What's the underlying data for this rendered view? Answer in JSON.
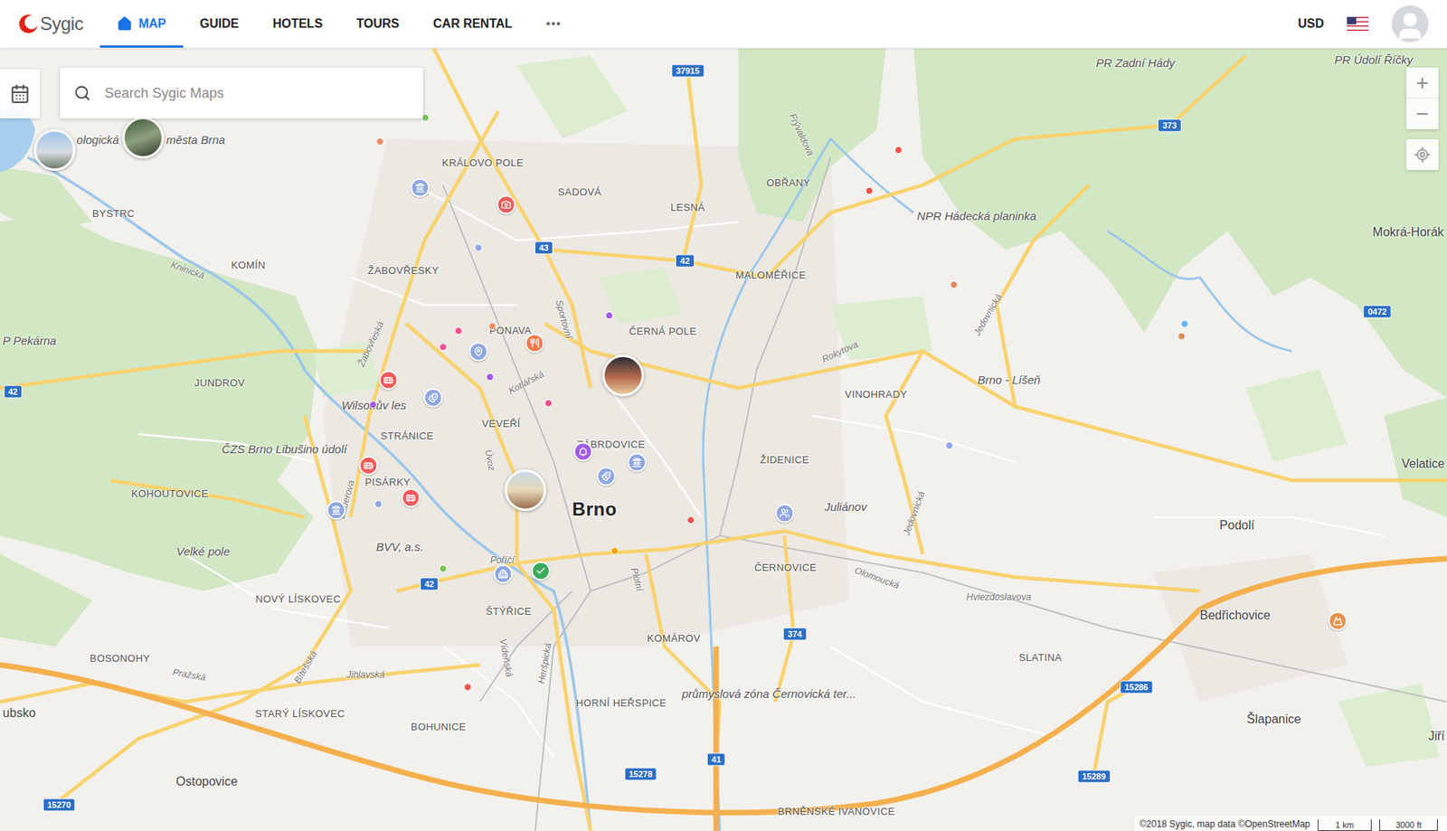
{
  "header": {
    "logo": "Sygic",
    "nav": [
      {
        "label": "MAP",
        "selected": true
      },
      {
        "label": "GUIDE",
        "selected": false
      },
      {
        "label": "HOTELS",
        "selected": false
      },
      {
        "label": "TOURS",
        "selected": false
      },
      {
        "label": "CAR RENTAL",
        "selected": false
      }
    ],
    "more": "•••",
    "currency": "USD"
  },
  "search": {
    "placeholder": "Search Sygic Maps"
  },
  "zoom": {
    "in": "+",
    "out": "−"
  },
  "map": {
    "labels": [
      {
        "text": "ologická",
        "kind": "area"
      },
      {
        "text": "města Brna",
        "kind": "area"
      },
      {
        "text": "KRÁLOVO POLE",
        "kind": "district"
      },
      {
        "text": "SADOVÁ",
        "kind": "district"
      },
      {
        "text": "LESNÁ",
        "kind": "district"
      },
      {
        "text": "OBŘANY",
        "kind": "district"
      },
      {
        "text": "PR Zadní Hády",
        "kind": "area"
      },
      {
        "text": "PR Údolí Říčky",
        "kind": "area"
      },
      {
        "text": "NPR Hádecká planinka",
        "kind": "area"
      },
      {
        "text": "Mokrá-Horák",
        "kind": "town"
      },
      {
        "text": "BYSTRC",
        "kind": "district"
      },
      {
        "text": "KOMÍN",
        "kind": "district"
      },
      {
        "text": "Kninická",
        "kind": "street"
      },
      {
        "text": "ŽABOVŘESKY",
        "kind": "district"
      },
      {
        "text": "PONAVA",
        "kind": "district"
      },
      {
        "text": "ČERNÁ POLE",
        "kind": "district"
      },
      {
        "text": "MALOMĚŘICE",
        "kind": "district"
      },
      {
        "text": "P Pekárna",
        "kind": "area"
      },
      {
        "text": "JUNDROV",
        "kind": "district"
      },
      {
        "text": "Wilsonův les",
        "kind": "area"
      },
      {
        "text": "Žabovřeská",
        "kind": "street"
      },
      {
        "text": "Sportovní",
        "kind": "street"
      },
      {
        "text": "Kotlářská",
        "kind": "street"
      },
      {
        "text": "VEVEŘÍ",
        "kind": "district"
      },
      {
        "text": "STRÁNICE",
        "kind": "district"
      },
      {
        "text": "ZÁBRDOVICE",
        "kind": "district"
      },
      {
        "text": "ŽIDENICE",
        "kind": "district"
      },
      {
        "text": "VINOHRADY",
        "kind": "district"
      },
      {
        "text": "Rokytova",
        "kind": "street"
      },
      {
        "text": "Brno - Líšeň",
        "kind": "area"
      },
      {
        "text": "Jedovnická",
        "kind": "street"
      },
      {
        "text": "ČZS Brno Libušino údolí",
        "kind": "area"
      },
      {
        "text": "PISÁRKY",
        "kind": "district"
      },
      {
        "text": "KOHOUTOVICE",
        "kind": "district"
      },
      {
        "text": "Brno",
        "kind": "city"
      },
      {
        "text": "Juliánov",
        "kind": "area"
      },
      {
        "text": "Jedovnická",
        "kind": "street"
      },
      {
        "text": "Podolí",
        "kind": "town"
      },
      {
        "text": "Velatice",
        "kind": "town"
      },
      {
        "text": "Velké pole",
        "kind": "area"
      },
      {
        "text": "BVV, a.s.",
        "kind": "area"
      },
      {
        "text": "Bauerova",
        "kind": "street"
      },
      {
        "text": "Úvoz",
        "kind": "street"
      },
      {
        "text": "Poříčí",
        "kind": "street"
      },
      {
        "text": "Plotní",
        "kind": "street"
      },
      {
        "text": "ČERNOVICE",
        "kind": "district"
      },
      {
        "text": "Olomoucká",
        "kind": "street"
      },
      {
        "text": "Hviezdoslavova",
        "kind": "street"
      },
      {
        "text": "NOVÝ LÍSKOVEC",
        "kind": "district"
      },
      {
        "text": "ŠTÝŘICE",
        "kind": "district"
      },
      {
        "text": "KOMÁROV",
        "kind": "district"
      },
      {
        "text": "Bedřichovice",
        "kind": "town"
      },
      {
        "text": "SLATINA",
        "kind": "district"
      },
      {
        "text": "BOSONOHY",
        "kind": "district"
      },
      {
        "text": "Pražská",
        "kind": "street"
      },
      {
        "text": "Jihlavská",
        "kind": "street"
      },
      {
        "text": "Bítešská",
        "kind": "street"
      },
      {
        "text": "Vídeňská",
        "kind": "street"
      },
      {
        "text": "Heršpická",
        "kind": "street"
      },
      {
        "text": "HORNÍ HEŘSPICE",
        "kind": "district"
      },
      {
        "text": "průmyslová zóna Černovická ter...",
        "kind": "area"
      },
      {
        "text": "ubsko",
        "kind": "town"
      },
      {
        "text": "STARÝ LÍSKOVEC",
        "kind": "district"
      },
      {
        "text": "BOHUNICE",
        "kind": "district"
      },
      {
        "text": "Šlapanice",
        "kind": "town"
      },
      {
        "text": "Jiří",
        "kind": "town"
      },
      {
        "text": "Ostopovice",
        "kind": "town"
      },
      {
        "text": "BRNĚNSKÉ IVANOVICE",
        "kind": "district"
      },
      {
        "text": "Frývaldova",
        "kind": "street"
      }
    ],
    "shields": [
      "37915",
      "373",
      "43",
      "42",
      "0472",
      "42",
      "42",
      "374",
      "15286",
      "41",
      "15278",
      "15289",
      "15270"
    ],
    "dots": [
      {
        "color": "#f28b62"
      },
      {
        "color": "#7cc35b"
      },
      {
        "color": "#ef5350"
      },
      {
        "color": "#ef5350"
      },
      {
        "color": "#d98c5f"
      },
      {
        "color": "#d98c5f"
      },
      {
        "color": "#64b5f6"
      },
      {
        "color": "#8fa7e0"
      },
      {
        "color": "#ef4f8b"
      },
      {
        "color": "#ef4f8b"
      },
      {
        "color": "#f28b62"
      },
      {
        "color": "#a259e6"
      },
      {
        "color": "#a259e6"
      },
      {
        "color": "#ef4f8b"
      },
      {
        "color": "#a259e6"
      },
      {
        "color": "#8fa7e0"
      },
      {
        "color": "#ef5350"
      },
      {
        "color": "#f0a500"
      },
      {
        "color": "#7cc35b"
      },
      {
        "color": "#ef5350"
      },
      {
        "color": "#8fa7e0"
      }
    ],
    "markers": [
      {
        "kind": "museum",
        "color": "#8fa7e0"
      },
      {
        "kind": "camera",
        "color": "#ef5b5b"
      },
      {
        "kind": "restaurant",
        "color": "#ef7b4b"
      },
      {
        "kind": "pin",
        "color": "#8fa7e0"
      },
      {
        "kind": "theater",
        "color": "#8fa7e0"
      },
      {
        "kind": "bus",
        "color": "#ef5b5b"
      },
      {
        "kind": "bus",
        "color": "#ef5b5b"
      },
      {
        "kind": "bus",
        "color": "#ef5b5b"
      },
      {
        "kind": "museum",
        "color": "#8fa7e0"
      },
      {
        "kind": "tree",
        "color": "#a259e6"
      },
      {
        "kind": "museum",
        "color": "#8fa7e0"
      },
      {
        "kind": "theater",
        "color": "#8fa7e0"
      },
      {
        "kind": "people",
        "color": "#8fa7e0"
      },
      {
        "kind": "church",
        "color": "#8fa7e0"
      },
      {
        "kind": "check",
        "color": "#3bab5d"
      },
      {
        "kind": "mountain",
        "color": "#e6934f"
      }
    ],
    "photos": [
      {
        "kind": "photo"
      },
      {
        "kind": "photo"
      },
      {
        "kind": "photo"
      },
      {
        "kind": "photo"
      }
    ]
  },
  "attribution": "©2018 Sygic, map data ©OpenStreetMap",
  "scale": {
    "metric": "1 km",
    "imperial": "3000 ft"
  }
}
